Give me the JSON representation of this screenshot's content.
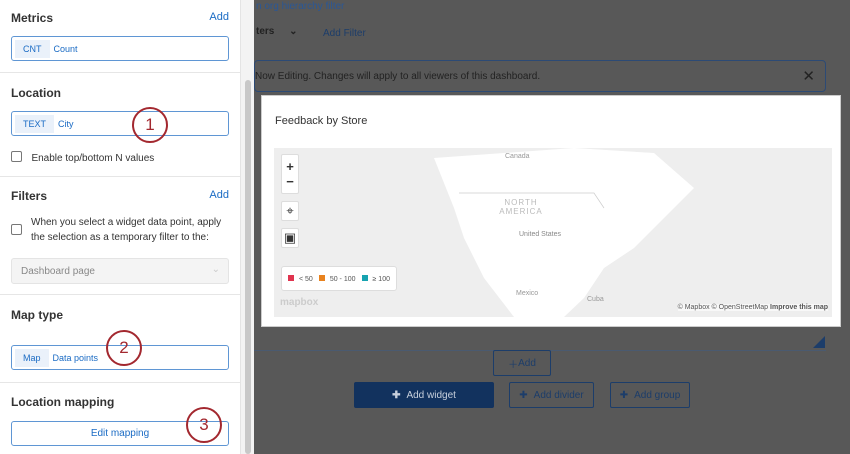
{
  "sidebar": {
    "metrics": {
      "title": "Metrics",
      "add": "Add",
      "tag": "CNT",
      "value": "Count"
    },
    "location": {
      "title": "Location",
      "tag": "TEXT",
      "value": "City",
      "checkbox": "Enable top/bottom N values"
    },
    "filters": {
      "title": "Filters",
      "add": "Add",
      "checkbox": "When you select a widget data point, apply the selection as a temporary filter to the:",
      "select": "Dashboard page"
    },
    "map_type": {
      "title": "Map type",
      "tag": "Map",
      "value": "Data points"
    },
    "location_mapping": {
      "title": "Location mapping",
      "button": "Edit mapping"
    }
  },
  "annotations": [
    "1",
    "2",
    "3"
  ],
  "background": {
    "org_filter": "n org hierarchy filter",
    "filters_label": "ters",
    "add_filter": "Add Filter",
    "banner": "Now Editing. Changes will apply to all viewers of this dashboard.",
    "add": "Add",
    "add_widget": "Add widget",
    "add_divider": "Add divider",
    "add_group": "Add group"
  },
  "widget": {
    "title": "Feedback by Store",
    "map_labels": {
      "canada": "Canada",
      "north_america": "NORTH AMERICA",
      "us": "United States",
      "mexico": "Mexico",
      "cuba": "Cuba"
    },
    "legend": [
      {
        "label": "< 50",
        "color": "#e0344f"
      },
      {
        "label": "50 - 100",
        "color": "#e8821e"
      },
      {
        "label": "≥ 100",
        "color": "#17a3b0"
      }
    ],
    "logo": "mapbox",
    "attribution": "© Mapbox © OpenStreetMap",
    "improve": "Improve this map"
  }
}
